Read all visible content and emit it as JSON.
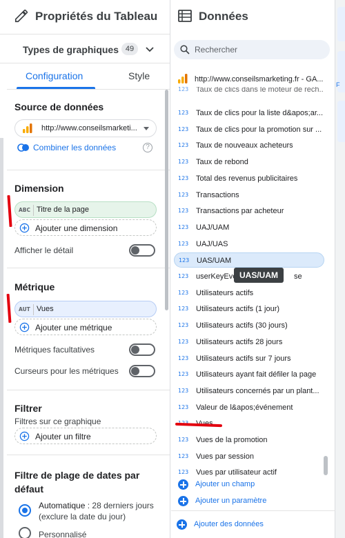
{
  "properties_panel": {
    "title": "Propriétés du Tableau",
    "chart_types_label": "Types de graphiques",
    "chart_types_count": "49",
    "tabs": {
      "configuration": "Configuration",
      "style": "Style"
    },
    "data_source": {
      "title": "Source de données",
      "selected": "http://www.conseilsmarketi...",
      "blend_label": "Combiner les données",
      "help": "?"
    },
    "dimension": {
      "title": "Dimension",
      "chip_type": "ABC",
      "chip_value": "Titre de la page",
      "add_label": "Ajouter une dimension",
      "drill_label": "Afficher le détail"
    },
    "metric": {
      "title": "Métrique",
      "chip_type": "AUT",
      "chip_value": "Vues",
      "add_label": "Ajouter une métrique",
      "optional_label": "Métriques facultatives",
      "sliders_label": "Curseurs pour les métriques"
    },
    "filter": {
      "title": "Filtrer",
      "subtitle": "Filtres sur ce graphique",
      "add_label": "Ajouter un filtre"
    },
    "date_range": {
      "title": "Filtre de plage de dates par défaut",
      "auto_label": "Automatique",
      "auto_detail": " : 28 derniers jours (exclure la date du jour)",
      "custom_label": "Personnalisé"
    }
  },
  "data_panel": {
    "title": "Données",
    "search_placeholder": "Rechercher",
    "source": "http://www.conseilsmarketing.fr - GA...",
    "type_tag": "123",
    "partial_top_item": "Taux de clics dans le moteur de rech...",
    "fields": [
      "Taux de clics pour la liste d&apos;ar...",
      "Taux de clics pour la promotion sur ...",
      "Taux de nouveaux acheteurs",
      "Taux de rebond",
      "Total des revenus publicitaires",
      "Transactions",
      "Transactions par acheteur",
      "UAJ/UAM",
      "UAJ/UAS",
      "UAS/UAM",
      "userKeyEve",
      "Utilisateurs actifs",
      "Utilisateurs actifs (1 jour)",
      "Utilisateurs actifs (30 jours)",
      "Utilisateurs actifs 28 jours",
      "Utilisateurs actifs sur 7 jours",
      "Utilisateurs ayant fait défiler la page",
      "Utilisateurs concernés par un plant...",
      "Valeur de l&apos;événement",
      "Vues",
      "Vues de la promotion",
      "Vues par session",
      "Vues par utilisateur actif"
    ],
    "hidden_suffix": "se",
    "selected_field": "UAS/UAM",
    "tooltip": "UAS/UAM",
    "add_field": "Ajouter un champ",
    "add_parameter": "Ajouter un paramètre",
    "add_data": "Ajouter des données"
  },
  "far_right": {
    "letter": "F"
  },
  "colors": {
    "accent": "#1a73e8",
    "annotation_red": "#e3000f",
    "selected_bg": "#dbeafb"
  }
}
